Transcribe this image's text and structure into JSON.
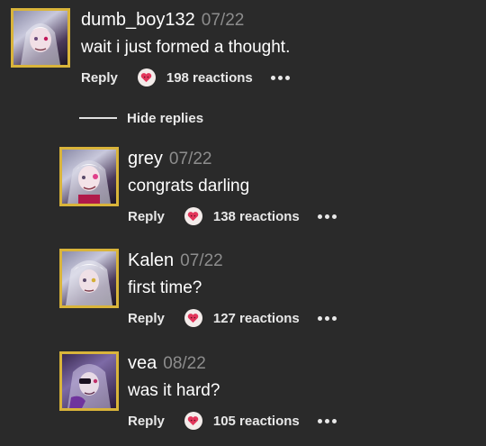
{
  "comments": [
    {
      "username": "dumb_boy132",
      "date": "07/22",
      "text": "wait i just formed a thought.",
      "reply_label": "Reply",
      "reactions": "198 reactions"
    },
    {
      "username": "grey",
      "date": "07/22",
      "text": "congrats darling",
      "reply_label": "Reply",
      "reactions": "138 reactions"
    },
    {
      "username": "Kalen",
      "date": "07/22",
      "text": "first time?",
      "reply_label": "Reply",
      "reactions": "127 reactions"
    },
    {
      "username": "vea",
      "date": "08/22",
      "text": "was it hard?",
      "reply_label": "Reply",
      "reactions": "105 reactions"
    }
  ],
  "thread": {
    "hide_replies_label": "Hide replies"
  },
  "icons": {
    "reaction": "heart-face-icon",
    "more": "more-dots-icon",
    "avatar_frame_color": "#d9b43a"
  }
}
